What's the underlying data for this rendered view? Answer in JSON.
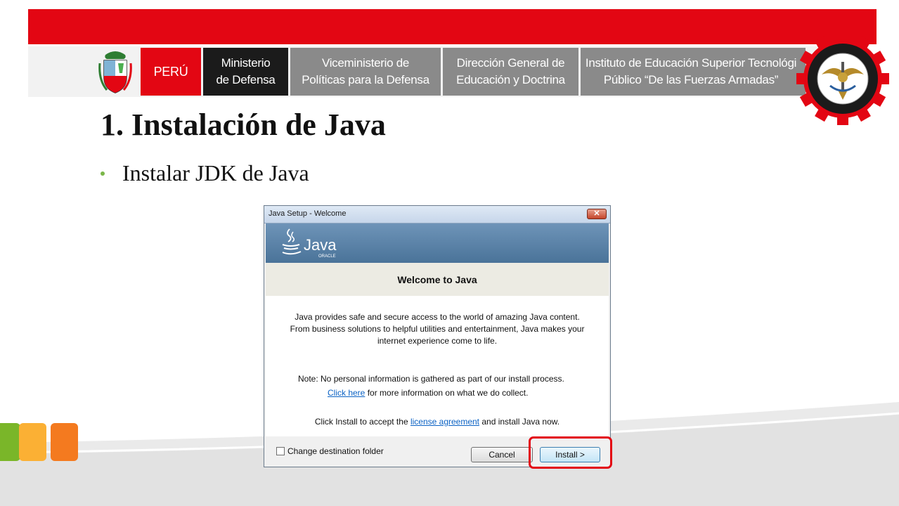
{
  "header": {
    "peru": "PERÚ",
    "ministerio": "Ministerio\nde Defensa",
    "viceministerio": "Viceministerio de\nPolíticas para la Defensa",
    "direccion": "Dirección General de\nEducación y Doctrina",
    "instituto": "Instituto de Educación Superior Tecnológi\nPúblico “De las Fuerzas Armadas”",
    "emblem_icon": "institute-emblem-icon",
    "crest_icon": "peru-coat-of-arms-icon"
  },
  "slide": {
    "title": "1. Instalación de Java",
    "bullet": "Instalar JDK de Java"
  },
  "dialog": {
    "title": "Java Setup - Welcome",
    "close_label": "✕",
    "logo_icon": "java-logo-icon",
    "heading": "Welcome to Java",
    "paragraph": "Java provides safe and secure access to the world of amazing Java content.\nFrom business solutions to helpful utilities and entertainment, Java makes your\ninternet experience come to life.",
    "note_text": "Note: No personal information is gathered as part of our install process.",
    "click_here": "Click here",
    "note_suffix": " for more information on what we do collect.",
    "install_prefix": "Click Install to accept the ",
    "license_link": "license agreement",
    "install_suffix": " and install Java now.",
    "checkbox_label": "Change destination folder",
    "checkbox_checked": false,
    "cancel_label": "Cancel",
    "install_label": "Install >"
  },
  "colors": {
    "brand_red": "#e30613",
    "bullet_green": "#7ab648",
    "accent_green": "#7ab629",
    "accent_yellow": "#fbb034",
    "accent_orange": "#f47a1f"
  }
}
